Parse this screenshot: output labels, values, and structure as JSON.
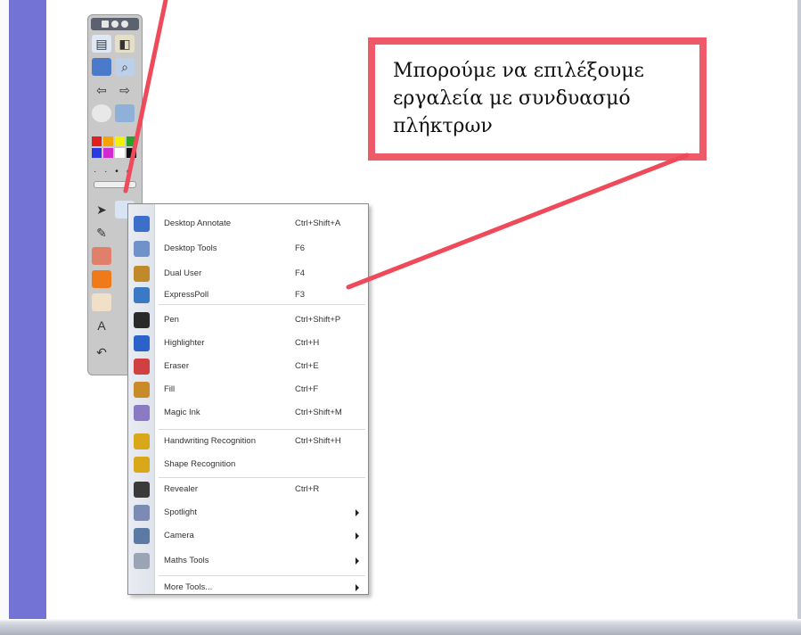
{
  "callout": {
    "text": "Μπορούμε να επιλέξουμε εργαλεία με συνδυασμό πλήκτρων"
  },
  "toolbar": {
    "head_icons": [
      "grid-icon",
      "circle-icon",
      "circle-icon"
    ],
    "colors": [
      "#e02020",
      "#f6a200",
      "#f2f200",
      "#2aa22a",
      "#2a3ae0",
      "#d02ad0",
      "#ffffff",
      "#111111"
    ]
  },
  "menu": {
    "items": [
      {
        "label": "Desktop Annotate",
        "shortcut": "Ctrl+Shift+A",
        "icon": "desktop-annotate-icon",
        "color": "#3b6fc9"
      },
      {
        "label": "Desktop Tools",
        "shortcut": "F6",
        "icon": "desktop-tools-icon",
        "color": "#6f92c9"
      },
      {
        "label": "Dual User",
        "shortcut": "F4",
        "icon": "dual-pen-icon",
        "color": "#c08a2a"
      },
      {
        "label": "ExpressPoll",
        "shortcut": "F3",
        "icon": "expresspoll-icon",
        "color": "#3a7ac4"
      },
      {
        "label": "Pen",
        "shortcut": "Ctrl+Shift+P",
        "icon": "pen-icon",
        "color": "#2a2a2a"
      },
      {
        "label": "Highlighter",
        "shortcut": "Ctrl+H",
        "icon": "highlighter-icon",
        "color": "#2a62c9"
      },
      {
        "label": "Eraser",
        "shortcut": "Ctrl+E",
        "icon": "eraser-icon",
        "color": "#d04040"
      },
      {
        "label": "Fill",
        "shortcut": "Ctrl+F",
        "icon": "fill-icon",
        "color": "#c98a2a"
      },
      {
        "label": "Magic Ink",
        "shortcut": "Ctrl+Shift+M",
        "icon": "magic-ink-icon",
        "color": "#8a7ac4"
      },
      {
        "label": "Handwriting Recognition",
        "shortcut": "Ctrl+Shift+H",
        "icon": "handwriting-recognition-icon",
        "color": "#d9a81a"
      },
      {
        "label": "Shape Recognition",
        "shortcut": "",
        "icon": "shape-recognition-icon",
        "color": "#d9a81a"
      },
      {
        "label": "Revealer",
        "shortcut": "Ctrl+R",
        "icon": "revealer-icon",
        "color": "#3a3a3a"
      },
      {
        "label": "Spotlight",
        "shortcut": "",
        "icon": "spotlight-icon",
        "color": "#7a8ab4",
        "submenu": true
      },
      {
        "label": "Camera",
        "shortcut": "",
        "icon": "camera-icon",
        "color": "#5a7aa4",
        "submenu": true
      },
      {
        "label": "Maths Tools",
        "shortcut": "",
        "icon": "maths-tools-icon",
        "color": "#9aa4b4",
        "submenu": true
      },
      {
        "label": "More Tools...",
        "shortcut": "",
        "icon": "",
        "color": "",
        "submenu": true
      }
    ]
  }
}
